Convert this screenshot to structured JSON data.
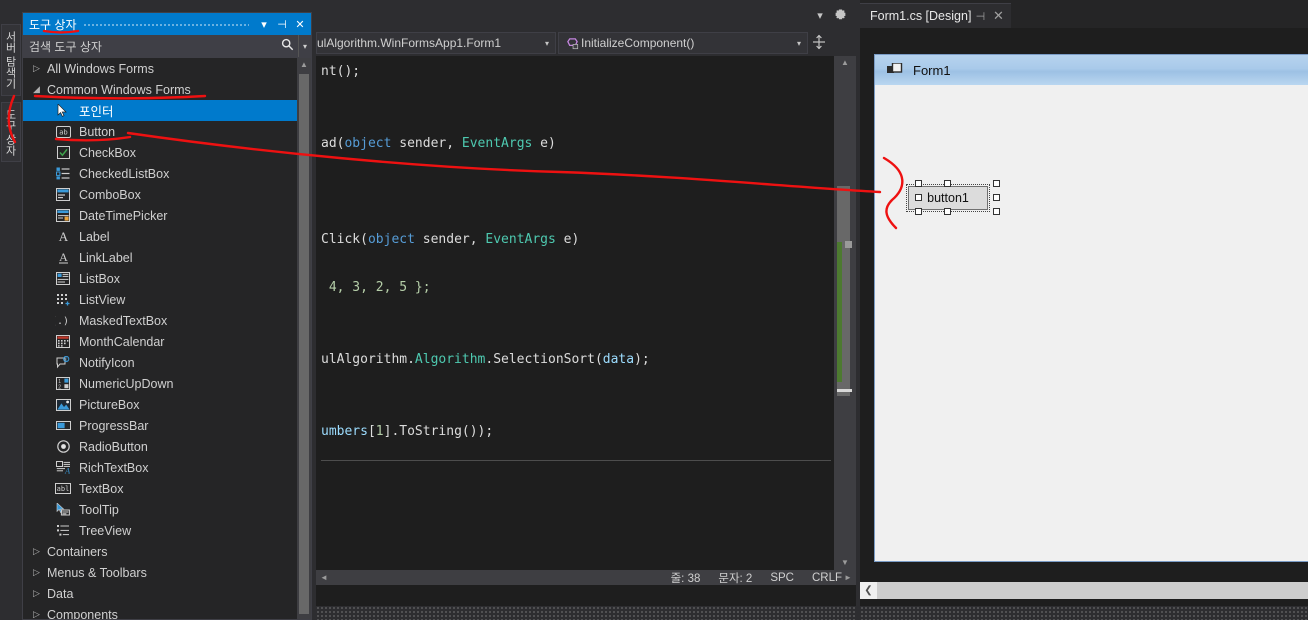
{
  "vertical_tabs": [
    {
      "label": "서버 탐색기",
      "name": "server-explorer"
    },
    {
      "label": "도구 상자",
      "name": "toolbox"
    }
  ],
  "toolbox": {
    "title": "도구 상자",
    "window_buttons": {
      "dropdown": "▾",
      "pin": "⊣",
      "close": "✕"
    },
    "search": {
      "value": "검색 도구 상자",
      "placeholder": "검색 도구 상자",
      "icon": "search-icon",
      "dropdown": "▾"
    },
    "groups_collapsed_top": [
      {
        "label": "All Windows Forms",
        "arrow": "▷",
        "expanded": false
      }
    ],
    "expanded_group": {
      "label": "Common Windows Forms",
      "arrow": "◢",
      "expanded": true
    },
    "items": [
      {
        "label": "포인터",
        "icon": "pointer-icon",
        "selected": true
      },
      {
        "label": "Button",
        "icon": "button-icon",
        "selected": false
      },
      {
        "label": "CheckBox",
        "icon": "checkbox-icon",
        "selected": false
      },
      {
        "label": "CheckedListBox",
        "icon": "checkedlistbox-icon",
        "selected": false
      },
      {
        "label": "ComboBox",
        "icon": "combobox-icon",
        "selected": false
      },
      {
        "label": "DateTimePicker",
        "icon": "datetimepicker-icon",
        "selected": false
      },
      {
        "label": "Label",
        "icon": "label-icon",
        "selected": false
      },
      {
        "label": "LinkLabel",
        "icon": "linklabel-icon",
        "selected": false
      },
      {
        "label": "ListBox",
        "icon": "listbox-icon",
        "selected": false
      },
      {
        "label": "ListView",
        "icon": "listview-icon",
        "selected": false
      },
      {
        "label": "MaskedTextBox",
        "icon": "maskedtextbox-icon",
        "selected": false
      },
      {
        "label": "MonthCalendar",
        "icon": "monthcalendar-icon",
        "selected": false
      },
      {
        "label": "NotifyIcon",
        "icon": "notifyicon-icon",
        "selected": false
      },
      {
        "label": "NumericUpDown",
        "icon": "numericupdown-icon",
        "selected": false
      },
      {
        "label": "PictureBox",
        "icon": "picturebox-icon",
        "selected": false
      },
      {
        "label": "ProgressBar",
        "icon": "progressbar-icon",
        "selected": false
      },
      {
        "label": "RadioButton",
        "icon": "radiobutton-icon",
        "selected": false
      },
      {
        "label": "RichTextBox",
        "icon": "richtextbox-icon",
        "selected": false
      },
      {
        "label": "TextBox",
        "icon": "textbox-icon",
        "selected": false
      },
      {
        "label": "ToolTip",
        "icon": "tooltip-icon",
        "selected": false
      },
      {
        "label": "TreeView",
        "icon": "treeview-icon",
        "selected": false
      }
    ],
    "groups_bottom": [
      {
        "label": "Containers",
        "arrow": "▷"
      },
      {
        "label": "Menus & Toolbars",
        "arrow": "▷"
      },
      {
        "label": "Data",
        "arrow": "▷"
      },
      {
        "label": "Components",
        "arrow": "▷"
      }
    ]
  },
  "editor": {
    "toolbar": {
      "dropdown": "▾",
      "settings_icon": "gear-icon"
    },
    "navbar": {
      "type_value": "ulAlgorithm.WinFormsApp1.Form1",
      "member_value": "InitializeComponent()",
      "member_icon": "method-private-icon",
      "caret": "▾",
      "split_icon": "split-editor-icon"
    },
    "code_lines": [
      {
        "tokens": [
          {
            "t": "nt();",
            "c": "pln"
          }
        ]
      },
      {
        "tokens": []
      },
      {
        "tokens": []
      },
      {
        "tokens": [
          {
            "t": "ad(",
            "c": "pln"
          },
          {
            "t": "object",
            "c": "kw"
          },
          {
            "t": " sender, ",
            "c": "pln"
          },
          {
            "t": "EventArgs",
            "c": "typ"
          },
          {
            "t": " e)",
            "c": "pln"
          }
        ]
      },
      {
        "tokens": []
      },
      {
        "tokens": []
      },
      {
        "tokens": []
      },
      {
        "tokens": [
          {
            "t": "Click(",
            "c": "pln"
          },
          {
            "t": "object",
            "c": "kw"
          },
          {
            "t": " sender, ",
            "c": "pln"
          },
          {
            "t": "EventArgs",
            "c": "typ"
          },
          {
            "t": " e)",
            "c": "pln"
          }
        ]
      },
      {
        "tokens": []
      },
      {
        "tokens": [
          {
            "t": " 4, 3, 2, 5 };",
            "c": "num"
          }
        ]
      },
      {
        "tokens": []
      },
      {
        "tokens": []
      },
      {
        "tokens": [
          {
            "t": "ulAlgorithm.",
            "c": "pln"
          },
          {
            "t": "Algorithm",
            "c": "typ"
          },
          {
            "t": ".SelectionSort(",
            "c": "pln"
          },
          {
            "t": "data",
            "c": "var"
          },
          {
            "t": ");",
            "c": "pln"
          }
        ]
      },
      {
        "tokens": []
      },
      {
        "tokens": []
      },
      {
        "tokens": [
          {
            "t": "umbers",
            "c": "var"
          },
          {
            "t": "[",
            "c": "pln"
          },
          {
            "t": "1",
            "c": "num"
          },
          {
            "t": "].ToString());",
            "c": "pln"
          }
        ]
      }
    ],
    "status": {
      "line_label": "줄: 38",
      "char_label": "문자: 2",
      "spacing": "SPC",
      "lineending": "CRLF"
    },
    "hscroll": {
      "left_arrow": "◄",
      "right_arrow": "►"
    },
    "vscroll": {
      "up_arrow": "▲",
      "down_arrow": "▼"
    }
  },
  "designer": {
    "tab": {
      "label": "Form1.cs [Design]",
      "pin": "⊣",
      "close": "✕"
    },
    "form": {
      "title": "Form1",
      "icon": "winform-icon"
    },
    "controls": [
      {
        "name": "button1",
        "label": "button1",
        "selected": true
      }
    ],
    "hscroll": {
      "left_arrow": "❮"
    }
  },
  "annotations": {
    "color": "#ee1111",
    "description": "red hand-drawn underlines under 도구 상자, Common Windows Forms, Button, and an arrow from Button to the button1 control on the form"
  }
}
